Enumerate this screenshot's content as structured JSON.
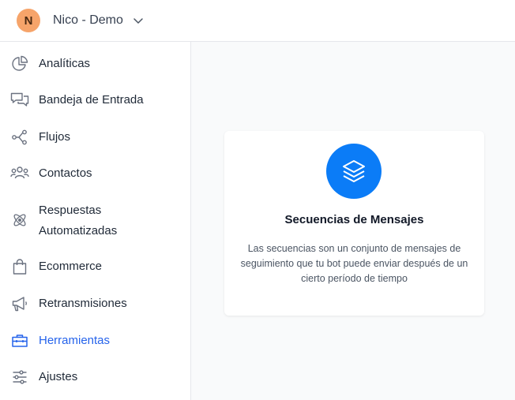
{
  "header": {
    "avatar_initial": "N",
    "workspace_name": "Nico - Demo"
  },
  "sidebar": {
    "items": [
      {
        "label": "Analíticas",
        "icon": "pie-chart-icon"
      },
      {
        "label": "Bandeja de Entrada",
        "icon": "chat-bubbles-icon"
      },
      {
        "label": "Flujos",
        "icon": "flow-nodes-icon"
      },
      {
        "label": "Contactos",
        "icon": "users-icon"
      },
      {
        "label": "Respuestas",
        "label2": "Automatizadas",
        "icon": "atom-icon"
      },
      {
        "label": "Ecommerce",
        "icon": "shopping-bag-icon"
      },
      {
        "label": "Retransmisiones",
        "icon": "megaphone-icon"
      },
      {
        "label": "Herramientas",
        "icon": "toolbox-icon",
        "active": true
      },
      {
        "label": "Ajustes",
        "icon": "sliders-icon"
      }
    ]
  },
  "main": {
    "card": {
      "icon": "layers-icon",
      "title": "Secuencias de Mensajes",
      "description": "Las secuencias son un conjunto de mensajes de seguimiento que tu bot puede enviar después de un cierto período de tiempo"
    }
  },
  "colors": {
    "accent": "#2563eb",
    "card_icon_bg": "#0b7cf7",
    "avatar_bg": "#f6a46a"
  }
}
